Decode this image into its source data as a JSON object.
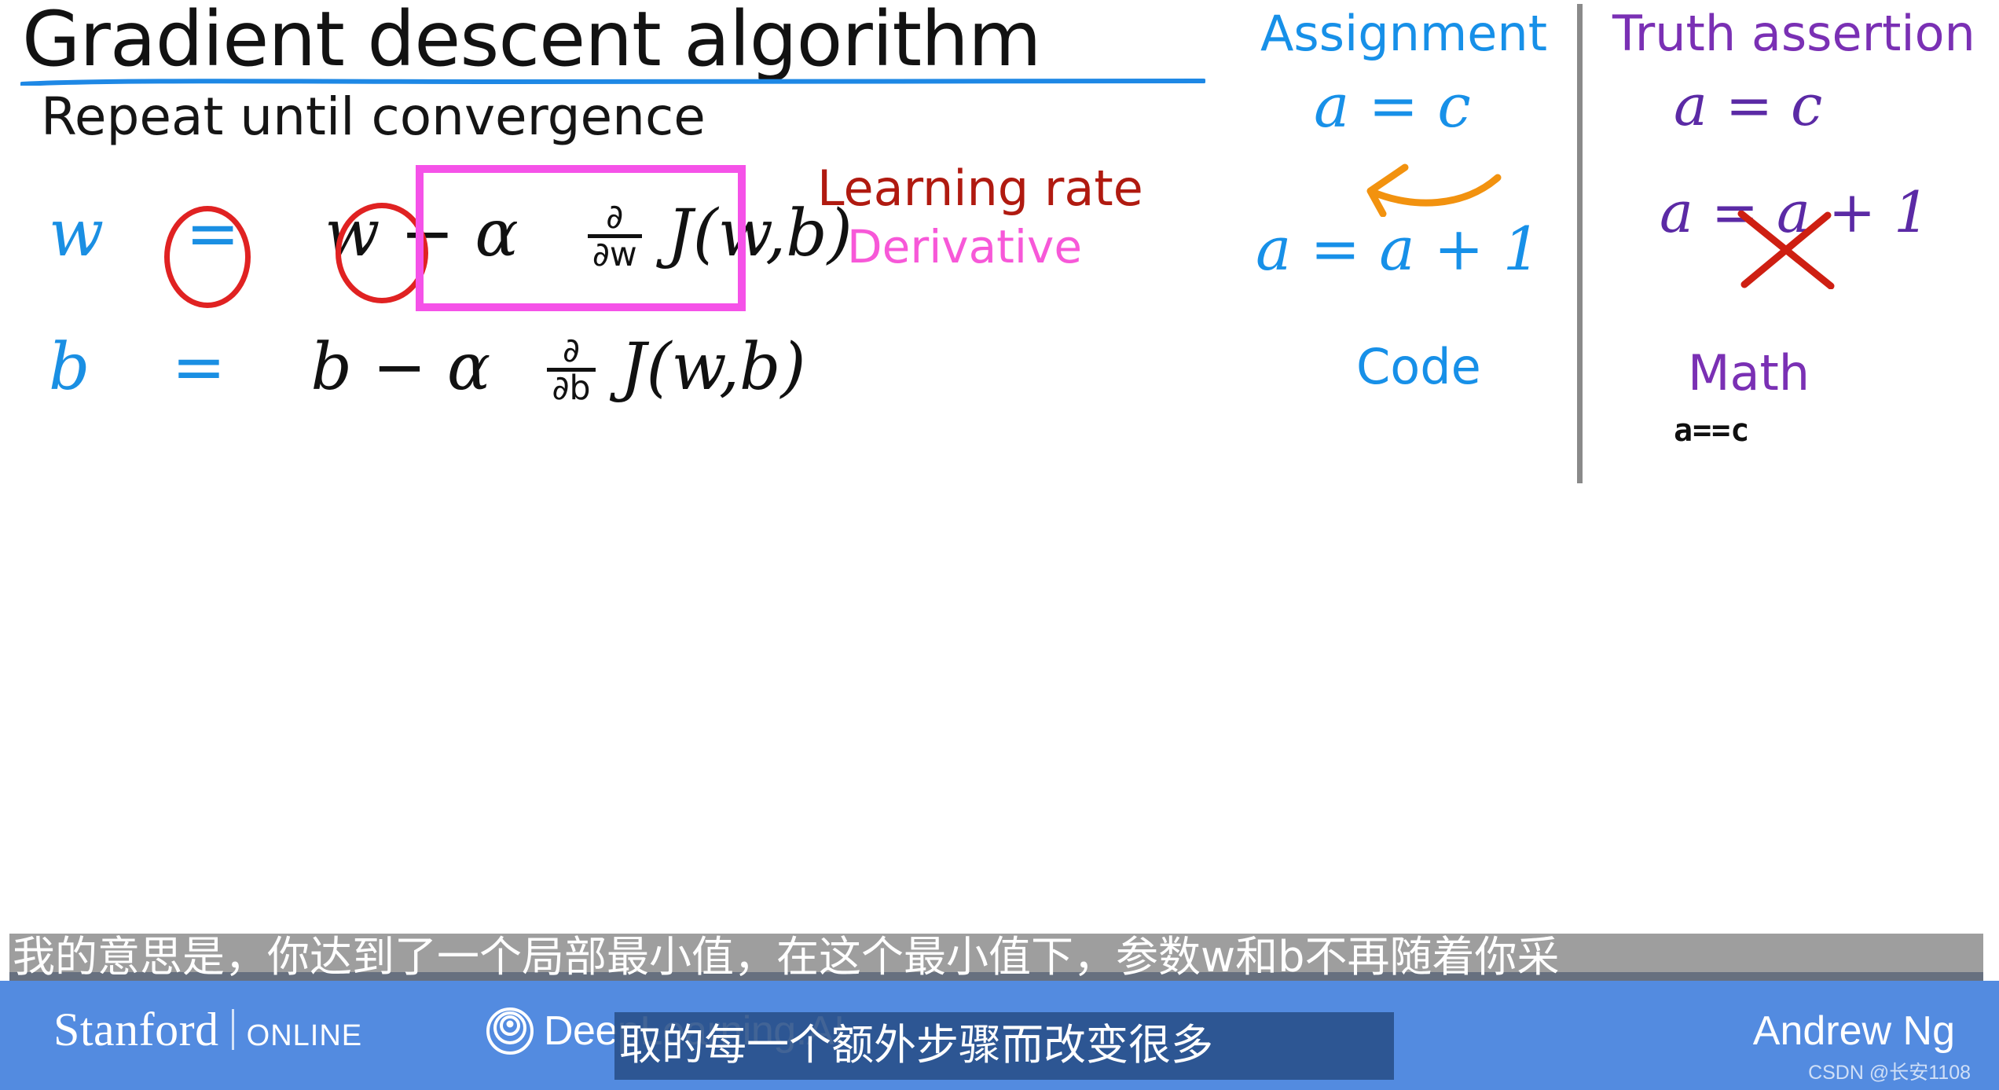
{
  "slide": {
    "title": "Gradient descent algorithm",
    "repeat_line": "Repeat until convergence"
  },
  "equations": {
    "w_update": {
      "lhs": "w",
      "assign_symbol": "=",
      "rhs_prefix": "w",
      "minus": "−",
      "alpha": "α",
      "derivative_num": "∂",
      "derivative_den": "∂w",
      "cost": "J(w,b)"
    },
    "b_update": {
      "lhs": "b",
      "assign_symbol": "=",
      "rhs_prefix": "b",
      "minus": "−",
      "alpha": "α",
      "derivative_num": "∂",
      "derivative_den": "∂b",
      "cost": "J(w,b)"
    }
  },
  "annotations": {
    "learning_rate": "Learning rate",
    "derivative": "Derivative"
  },
  "assignment_column": {
    "heading": "Assignment",
    "line1": "a = c",
    "line2": "a = a + 1",
    "footer": "Code"
  },
  "truth_column": {
    "heading": "Truth assertion",
    "line1": "a = c",
    "line2": "a = a + 1",
    "footer": "Math",
    "code_form": "a==c"
  },
  "footer": {
    "stanford_word": "Stanford",
    "stanford_online": "ONLINE",
    "deeplearning_text": "DeepLearning.AI",
    "deeplearning_mark": "concentric-rings-icon",
    "presenter": "Andrew Ng",
    "watermark": "CSDN @长安1108"
  },
  "subtitles": {
    "line1": "我的意思是，你达到了一个局部最小值，在这个最小值下，参数w和b不再随着你采",
    "line2": "取的每一个额外步骤而改变很多"
  },
  "colors": {
    "ink_blue": "#1A8FE3",
    "ink_black": "#111111",
    "circle_red": "#E02222",
    "box_magenta": "#F552E8",
    "learning_rate_red": "#B01A10",
    "derivative_pink": "#F758D8",
    "assignment_blue": "#1790E8",
    "truth_purple": "#7A30B4",
    "arrow_orange": "#F2920F",
    "cross_red": "#CE1F12",
    "footer_blue": "#538BE0",
    "divider_gray": "#8A8A8A",
    "title_underline_blue": "#1E88E5"
  }
}
